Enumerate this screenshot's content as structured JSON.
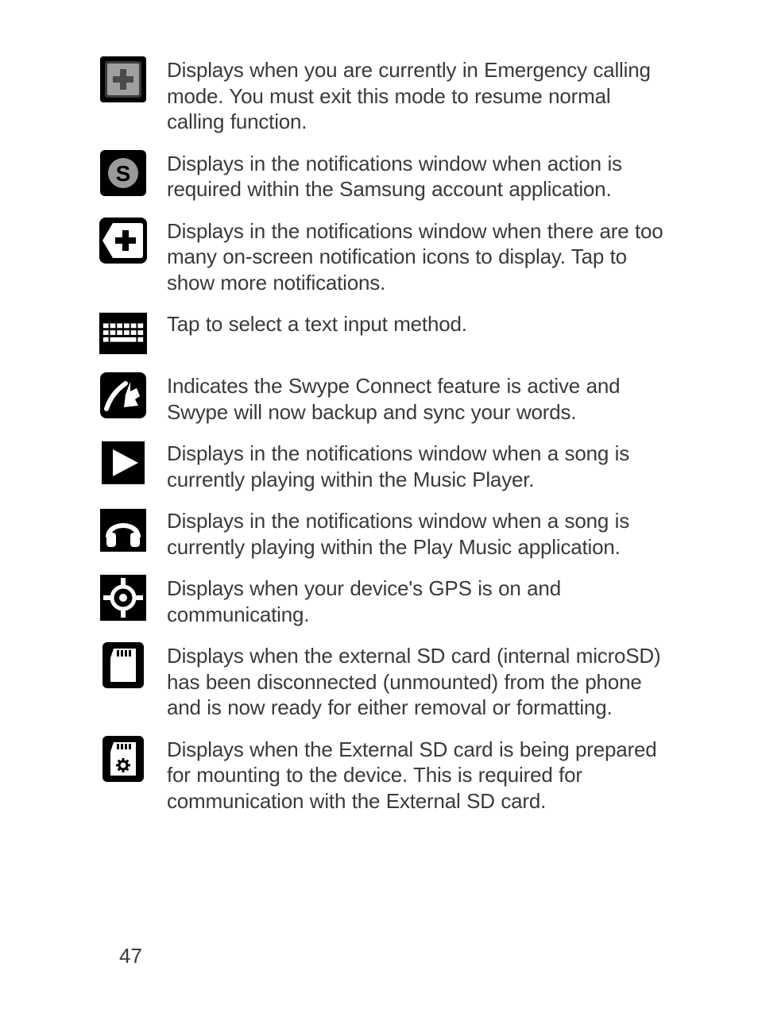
{
  "page_number": "47",
  "items": [
    {
      "icon_name": "emergency-call-plus-icon",
      "description": "Displays when you are currently in Emergency calling mode. You must exit this mode to resume normal calling function."
    },
    {
      "icon_name": "samsung-account-s-icon",
      "description": "Displays in the notifications window when action is required within the Samsung account application."
    },
    {
      "icon_name": "more-notifications-plus-arrow-icon",
      "description": "Displays in the notifications window when there are too many on-screen notification icons to display. Tap to show more notifications."
    },
    {
      "icon_name": "keyboard-icon",
      "description": "Tap to select a text input method."
    },
    {
      "icon_name": "swype-connect-icon",
      "description": "Indicates the Swype Connect feature is active and Swype will now backup and sync your words."
    },
    {
      "icon_name": "play-triangle-icon",
      "description": "Displays in the notifications window when a song is currently playing within the Music Player."
    },
    {
      "icon_name": "headphones-icon",
      "description": "Displays in the notifications window when a song is currently playing within the Play Music application."
    },
    {
      "icon_name": "gps-target-icon",
      "description": "Displays when your device's GPS is on and communicating."
    },
    {
      "icon_name": "sd-card-unmounted-icon",
      "description": "Displays when the external SD card (internal microSD) has been disconnected (unmounted) from the phone and is now ready for either removal or formatting."
    },
    {
      "icon_name": "sd-card-preparing-icon",
      "description": "Displays when the External SD card is being prepared for mounting to the device. This is required for communication with the External SD card."
    }
  ]
}
